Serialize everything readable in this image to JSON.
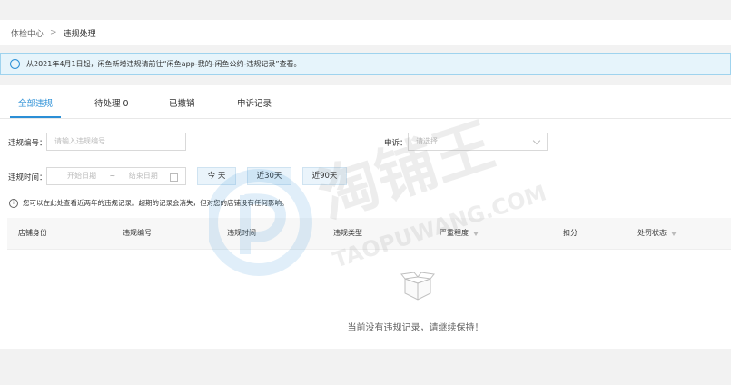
{
  "breadcrumb": {
    "root": "体检中心",
    "separator": ">",
    "current": "违规处理"
  },
  "notice": {
    "text": "从2021年4月1日起，闲鱼新增违规请前往“闲鱼app-我的-闲鱼公约-违规记录”查看。"
  },
  "tabs": [
    {
      "label": "全部违规",
      "active": true
    },
    {
      "label": "待处理 0",
      "active": false
    },
    {
      "label": "已撤销",
      "active": false
    },
    {
      "label": "申诉记录",
      "active": false
    }
  ],
  "filters": {
    "violation_no_label": "违规编号：",
    "violation_no_placeholder": "请输入违规编号",
    "appeal_label": "申诉：",
    "appeal_placeholder": "请选择",
    "time_label": "违规时间：",
    "start_placeholder": "开始日期",
    "range_sep": "~",
    "end_placeholder": "结束日期",
    "btn_today": "今 天",
    "btn_30": "近30天",
    "btn_90": "近90天"
  },
  "tip": "您可以在此处查看近两年的违规记录。超期的记录会消失，但对您的店铺没有任何影响。",
  "table": {
    "columns": [
      "店铺身份",
      "违规编号",
      "违规时间",
      "违规类型",
      "严重程度",
      "扣分",
      "处罚状态"
    ]
  },
  "empty_text": "当前没有违规记录，请继续保持！",
  "watermark": {
    "cn": "淘铺王",
    "en": "TAOPUWANG.COM"
  },
  "colors": {
    "accent": "#2b8fd6",
    "notice_bg": "#e6f4fb",
    "page_bg": "#f2f2f2"
  }
}
